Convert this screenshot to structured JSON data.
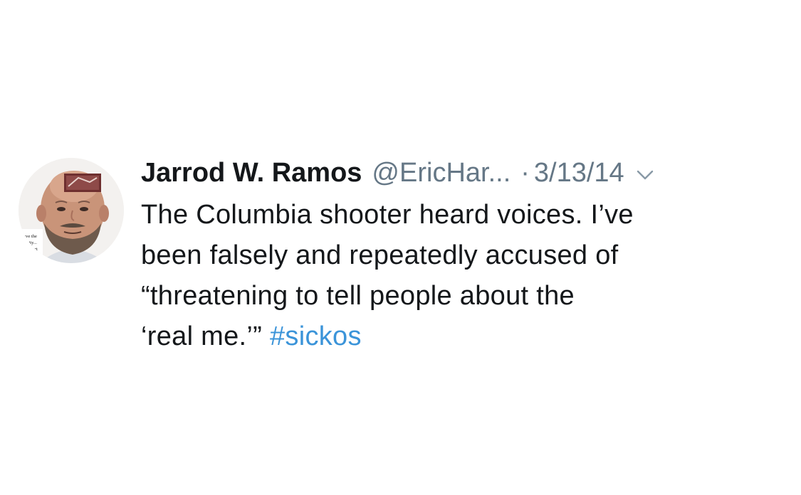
{
  "tweet": {
    "author": {
      "display_name": "Jarrod W. Ramos",
      "handle": "@EricHar...",
      "avatar_caption": [
        "have the",
        "unity...",
        "Court"
      ]
    },
    "separator": "·",
    "date": "3/13/14",
    "text_lines": [
      "The Columbia shooter heard voices. I’ve",
      "been falsely and repeatedly accused of",
      "“threatening to tell people about the",
      "‘real me.’”"
    ],
    "hashtag": "#sickos",
    "icons": {
      "menu": "chevron-down-icon"
    },
    "colors": {
      "text": "#14171a",
      "secondary": "#657786",
      "link": "#3b94d9"
    }
  }
}
